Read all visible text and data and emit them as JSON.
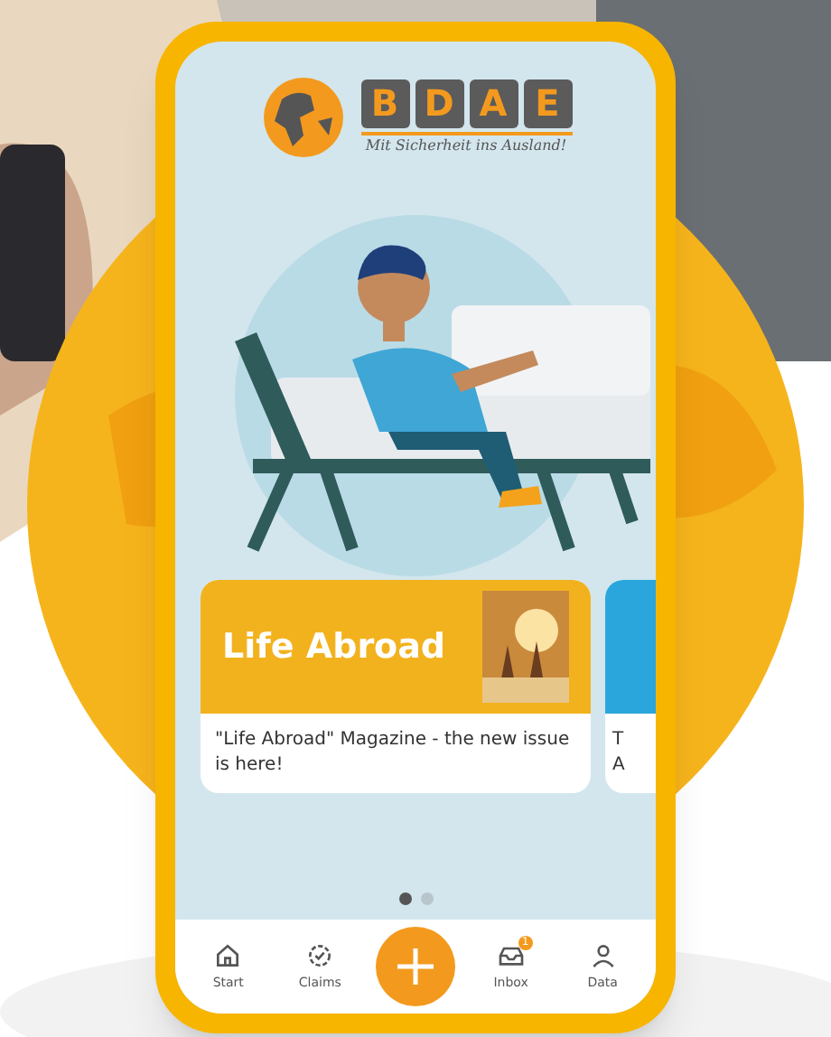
{
  "logo": {
    "letters": [
      "B",
      "D",
      "A",
      "E"
    ],
    "tagline": "Mit Sicherheit ins Ausland!"
  },
  "cards": [
    {
      "banner": "Life Abroad",
      "text": "\"Life Abroad\" Magazine - the new issue is here!"
    },
    {
      "lines": [
        "T",
        "A"
      ]
    }
  ],
  "pager": [
    {
      "selected": true
    },
    {
      "selected": false
    }
  ],
  "nav": [
    {
      "kind": "home",
      "label": "Start"
    },
    {
      "kind": "claims",
      "label": "Claims"
    },
    {
      "kind": "add"
    },
    {
      "kind": "inbox",
      "label": "Inbox",
      "badge": "1"
    },
    {
      "kind": "person",
      "label": "Data"
    }
  ]
}
